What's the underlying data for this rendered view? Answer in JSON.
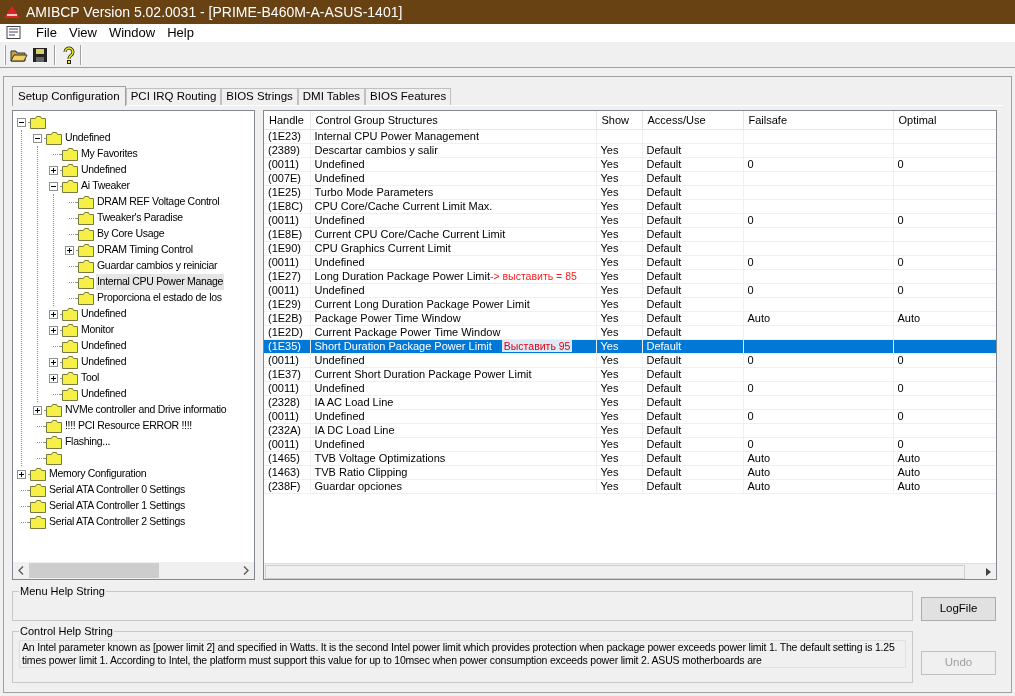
{
  "window": {
    "title": "AMIBCP Version 5.02.0031 - [PRIME-B460M-A-ASUS-1401]"
  },
  "menu": [
    "File",
    "View",
    "Window",
    "Help"
  ],
  "tabs": [
    {
      "label": "Setup Configuration",
      "selected": true
    },
    {
      "label": "PCI IRQ Routing",
      "selected": false
    },
    {
      "label": "BIOS Strings",
      "selected": false
    },
    {
      "label": "DMI Tables",
      "selected": false
    },
    {
      "label": "BIOS Features",
      "selected": false
    }
  ],
  "tree": [
    {
      "expanded": true,
      "selected": false,
      "children": [
        {
          "label": "Undefined",
          "expanded": true,
          "selected": false,
          "children": [
            {
              "label": "My Favorites",
              "selected": false
            },
            {
              "label": "Undefined",
              "expanded": false,
              "selected": false
            },
            {
              "label": "Ai Tweaker",
              "expanded": true,
              "selected": false,
              "children": [
                {
                  "label": "DRAM REF Voltage Control",
                  "selected": false
                },
                {
                  "label": "Tweaker's Paradise",
                  "selected": false
                },
                {
                  "label": "By Core Usage",
                  "selected": false
                },
                {
                  "label": "DRAM Timing Control",
                  "expanded": false,
                  "selected": false
                },
                {
                  "label": "Guardar cambios y reiniciar",
                  "selected": false
                },
                {
                  "label": "Internal CPU Power Manage",
                  "selected": true
                },
                {
                  "label": "Proporciona el estado de los",
                  "selected": false
                }
              ]
            },
            {
              "label": "Undefined",
              "expanded": false,
              "selected": false
            },
            {
              "label": "Monitor",
              "expanded": false,
              "selected": false
            },
            {
              "label": "Undefined",
              "selected": false
            },
            {
              "label": "Undefined",
              "expanded": false,
              "selected": false
            },
            {
              "label": "Tool",
              "expanded": false,
              "selected": false
            },
            {
              "label": "Undefined",
              "selected": false
            }
          ]
        },
        {
          "label": "NVMe controller and Drive informatio",
          "expanded": false,
          "selected": false
        },
        {
          "label": "!!!! PCI Resource ERROR !!!!",
          "selected": false
        },
        {
          "label": "Flashing...",
          "selected": false
        },
        {
          "selected": false
        }
      ]
    },
    {
      "label": "Memory Configuration",
      "expanded": false,
      "selected": false
    },
    {
      "label": "Serial ATA Controller 0 Settings",
      "selected": false
    },
    {
      "label": "Serial ATA Controller 1 Settings",
      "selected": false
    },
    {
      "label": "Serial ATA Controller 2 Settings",
      "selected": false
    }
  ],
  "table": {
    "columns": [
      "Handle",
      "Control Group Structures",
      "Show",
      "Access/Use",
      "Failsafe",
      "Optimal"
    ],
    "rows": [
      {
        "handle": "(1E23)",
        "structure": "Internal CPU Power Management",
        "selected": false
      },
      {
        "handle": "(2389)",
        "structure": "Descartar cambios y salir",
        "show": "Yes",
        "access": "Default",
        "selected": false
      },
      {
        "handle": "(0011)",
        "structure": "Undefined",
        "show": "Yes",
        "access": "Default",
        "failsafe": "0",
        "optimal": "0",
        "selected": false
      },
      {
        "handle": "(007E)",
        "structure": "Undefined",
        "show": "Yes",
        "access": "Default",
        "selected": false
      },
      {
        "handle": "(1E25)",
        "structure": "Turbo Mode Parameters",
        "show": "Yes",
        "access": "Default",
        "selected": false
      },
      {
        "handle": "(1E8C)",
        "structure": "CPU Core/Cache Current Limit Max.",
        "show": "Yes",
        "access": "Default",
        "selected": false
      },
      {
        "handle": "(0011)",
        "structure": "Undefined",
        "show": "Yes",
        "access": "Default",
        "failsafe": "0",
        "optimal": "0",
        "selected": false
      },
      {
        "handle": "(1E8E)",
        "structure": "Current CPU Core/Cache Current Limit",
        "show": "Yes",
        "access": "Default",
        "selected": false
      },
      {
        "handle": "(1E90)",
        "structure": "CPU Graphics Current Limit",
        "show": "Yes",
        "access": "Default",
        "selected": false
      },
      {
        "handle": "(0011)",
        "structure": "Undefined",
        "show": "Yes",
        "access": "Default",
        "failsafe": "0",
        "optimal": "0",
        "selected": false
      },
      {
        "handle": "(1E27)",
        "structure": "Long Duration Package Power Limit",
        "note": "-> выставить = 85",
        "show": "Yes",
        "access": "Default",
        "selected": false
      },
      {
        "handle": "(0011)",
        "structure": "Undefined",
        "show": "Yes",
        "access": "Default",
        "failsafe": "0",
        "optimal": "0",
        "selected": false
      },
      {
        "handle": "(1E29)",
        "structure": "Current Long Duration Package Power Limit",
        "show": "Yes",
        "access": "Default",
        "selected": false
      },
      {
        "handle": "(1E2B)",
        "structure": "Package Power Time Window",
        "show": "Yes",
        "access": "Default",
        "failsafe": "Auto",
        "optimal": "Auto",
        "selected": false
      },
      {
        "handle": "(1E2D)",
        "structure": "Current Package Power Time Window",
        "show": "Yes",
        "access": "Default",
        "selected": false
      },
      {
        "handle": "(1E35)",
        "structure": "Short Duration Package Power Limit",
        "note": "Выставить 95",
        "show": "Yes",
        "access": "Default",
        "selected": true
      },
      {
        "handle": "(0011)",
        "structure": "Undefined",
        "show": "Yes",
        "access": "Default",
        "failsafe": "0",
        "optimal": "0",
        "selected": false
      },
      {
        "handle": "(1E37)",
        "structure": "Current Short Duration Package Power Limit",
        "show": "Yes",
        "access": "Default",
        "selected": false
      },
      {
        "handle": "(0011)",
        "structure": "Undefined",
        "show": "Yes",
        "access": "Default",
        "failsafe": "0",
        "optimal": "0",
        "selected": false
      },
      {
        "handle": "(2328)",
        "structure": "IA AC Load Line",
        "show": "Yes",
        "access": "Default",
        "selected": false
      },
      {
        "handle": "(0011)",
        "structure": "Undefined",
        "show": "Yes",
        "access": "Default",
        "failsafe": "0",
        "optimal": "0",
        "selected": false
      },
      {
        "handle": "(232A)",
        "structure": "IA DC Load Line",
        "show": "Yes",
        "access": "Default",
        "selected": false
      },
      {
        "handle": "(0011)",
        "structure": "Undefined",
        "show": "Yes",
        "access": "Default",
        "failsafe": "0",
        "optimal": "0",
        "selected": false
      },
      {
        "handle": "(1465)",
        "structure": "TVB Voltage Optimizations",
        "show": "Yes",
        "access": "Default",
        "failsafe": "Auto",
        "optimal": "Auto",
        "selected": false
      },
      {
        "handle": "(1463)",
        "structure": "TVB Ratio Clipping",
        "show": "Yes",
        "access": "Default",
        "failsafe": "Auto",
        "optimal": "Auto",
        "selected": false
      },
      {
        "handle": "(238F)",
        "structure": "Guardar opciones",
        "show": "Yes",
        "access": "Default",
        "failsafe": "Auto",
        "optimal": "Auto",
        "selected": false
      }
    ]
  },
  "menu_help": {
    "title": "Menu Help String"
  },
  "control_help": {
    "title": "Control Help String",
    "text": "An Intel parameter known as [power limit 2] and specified in Watts. It is the second Intel power limit which provides protection when package power exceeds power limit 1. The default setting is 1.25 times power limit 1. According to Intel, the platform must support this value for up to 10msec when power consumption exceeds power limit 2. ASUS motherboards are"
  },
  "buttons": [
    {
      "label": "LogFile",
      "disabled": false
    },
    {
      "label": "Undo",
      "disabled": true
    }
  ]
}
